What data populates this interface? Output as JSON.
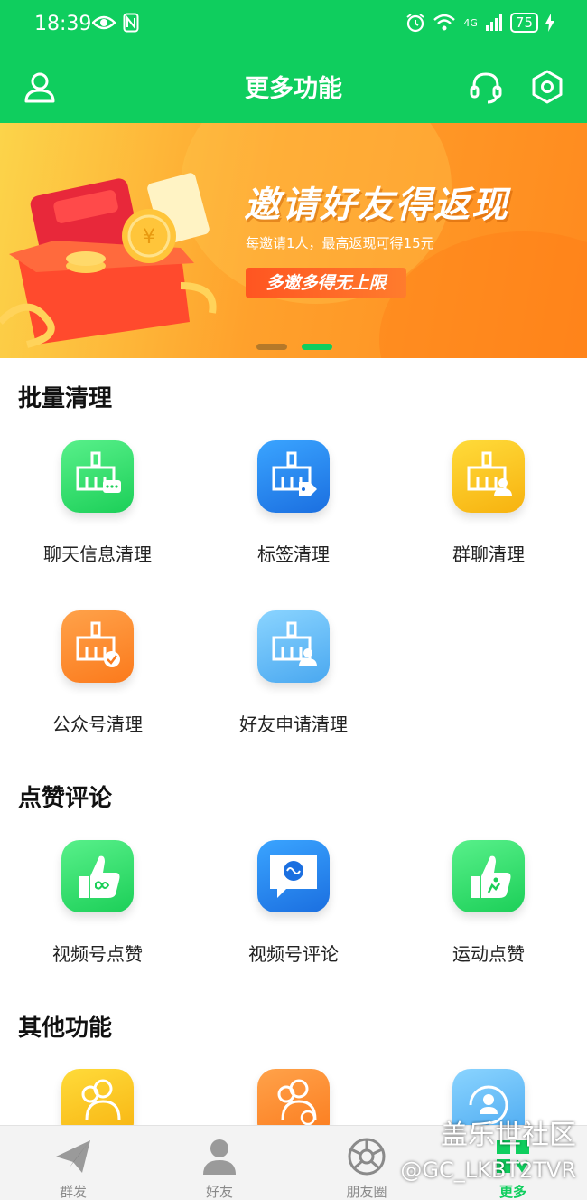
{
  "status_bar": {
    "time": "18:39",
    "battery": "75",
    "signal": "4G"
  },
  "header": {
    "title": "更多功能"
  },
  "banner": {
    "title": "邀请好友得返现",
    "subtitle": "每邀请1人，最高返现可得15元",
    "button": "多邀多得无上限"
  },
  "sections": {
    "batch_clean": {
      "title": "批量清理",
      "items": [
        {
          "label": "聊天信息清理"
        },
        {
          "label": "标签清理"
        },
        {
          "label": "群聊清理"
        },
        {
          "label": "公众号清理"
        },
        {
          "label": "好友申请清理"
        }
      ]
    },
    "like_comment": {
      "title": "点赞评论",
      "items": [
        {
          "label": "视频号点赞"
        },
        {
          "label": "视频号评论"
        },
        {
          "label": "运动点赞"
        }
      ]
    },
    "other": {
      "title": "其他功能"
    }
  },
  "tabbar": {
    "items": [
      {
        "label": "群发"
      },
      {
        "label": "好友"
      },
      {
        "label": "朋友圈"
      },
      {
        "label": "更多"
      }
    ]
  },
  "watermark": {
    "line1": "盖乐世社区",
    "line2": "@GC_LKBT2TVR"
  },
  "colors": {
    "brand_green": "#0fce5e",
    "banner_orange": "#ff8a1e"
  }
}
